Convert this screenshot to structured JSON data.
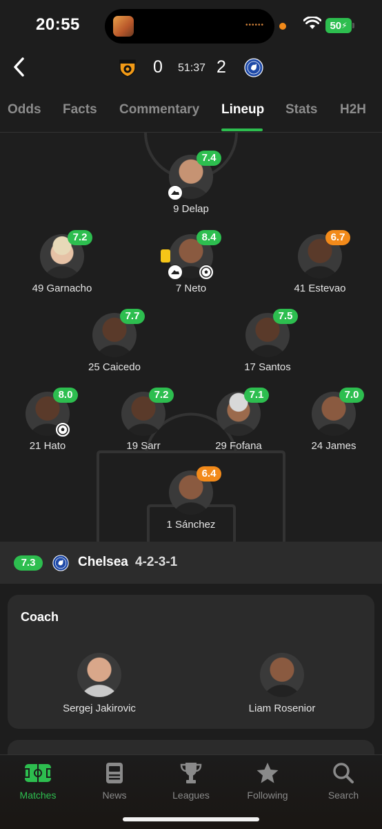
{
  "status_bar": {
    "time": "20:55",
    "battery": "50"
  },
  "match": {
    "home_score": "0",
    "away_score": "2",
    "clock": "51:37",
    "home_crest_icon": "hull-city-crest",
    "away_crest_icon": "chelsea-crest"
  },
  "tabs": [
    {
      "label": "Odds",
      "active": false
    },
    {
      "label": "Facts",
      "active": false
    },
    {
      "label": "Commentary",
      "active": false
    },
    {
      "label": "Lineup",
      "active": true
    },
    {
      "label": "Stats",
      "active": false
    },
    {
      "label": "H2H",
      "active": false
    }
  ],
  "lineup": {
    "players": [
      {
        "name": "9 Delap",
        "rating": "7.4",
        "rating_color": "green",
        "events": [
          "boot-icon"
        ]
      },
      {
        "name": "49 Garnacho",
        "rating": "7.2",
        "rating_color": "green",
        "events": []
      },
      {
        "name": "7 Neto",
        "rating": "8.4",
        "rating_color": "green",
        "events": [
          "yellow-card-icon",
          "boot-icon",
          "goal-ball-icon"
        ]
      },
      {
        "name": "41 Estevao",
        "rating": "6.7",
        "rating_color": "orange",
        "events": []
      },
      {
        "name": "25 Caicedo",
        "rating": "7.7",
        "rating_color": "green",
        "events": []
      },
      {
        "name": "17 Santos",
        "rating": "7.5",
        "rating_color": "green",
        "events": []
      },
      {
        "name": "21 Hato",
        "rating": "8.0",
        "rating_color": "green",
        "events": [
          "goal-ball-icon"
        ]
      },
      {
        "name": "19 Sarr",
        "rating": "7.2",
        "rating_color": "green",
        "events": []
      },
      {
        "name": "29 Fofana",
        "rating": "7.1",
        "rating_color": "green",
        "events": []
      },
      {
        "name": "24 James",
        "rating": "7.0",
        "rating_color": "green",
        "events": []
      },
      {
        "name": "1 Sánchez",
        "rating": "6.4",
        "rating_color": "orange",
        "events": []
      }
    ]
  },
  "team_bar": {
    "rating": "7.3",
    "name": "Chelsea",
    "formation": "4-2-3-1"
  },
  "coach": {
    "title": "Coach",
    "coaches": [
      {
        "name": "Sergej Jakirovic"
      },
      {
        "name": "Liam Rosenior"
      }
    ]
  },
  "bottom_nav": [
    {
      "label": "Matches",
      "icon": "pitch-icon",
      "active": true
    },
    {
      "label": "News",
      "icon": "news-icon",
      "active": false
    },
    {
      "label": "Leagues",
      "icon": "trophy-icon",
      "active": false
    },
    {
      "label": "Following",
      "icon": "star-icon",
      "active": false
    },
    {
      "label": "Search",
      "icon": "search-icon",
      "active": false
    }
  ],
  "colors": {
    "accent_green": "#2dbe4f",
    "rating_orange": "#f28a1a",
    "background": "#1d1d1d"
  }
}
